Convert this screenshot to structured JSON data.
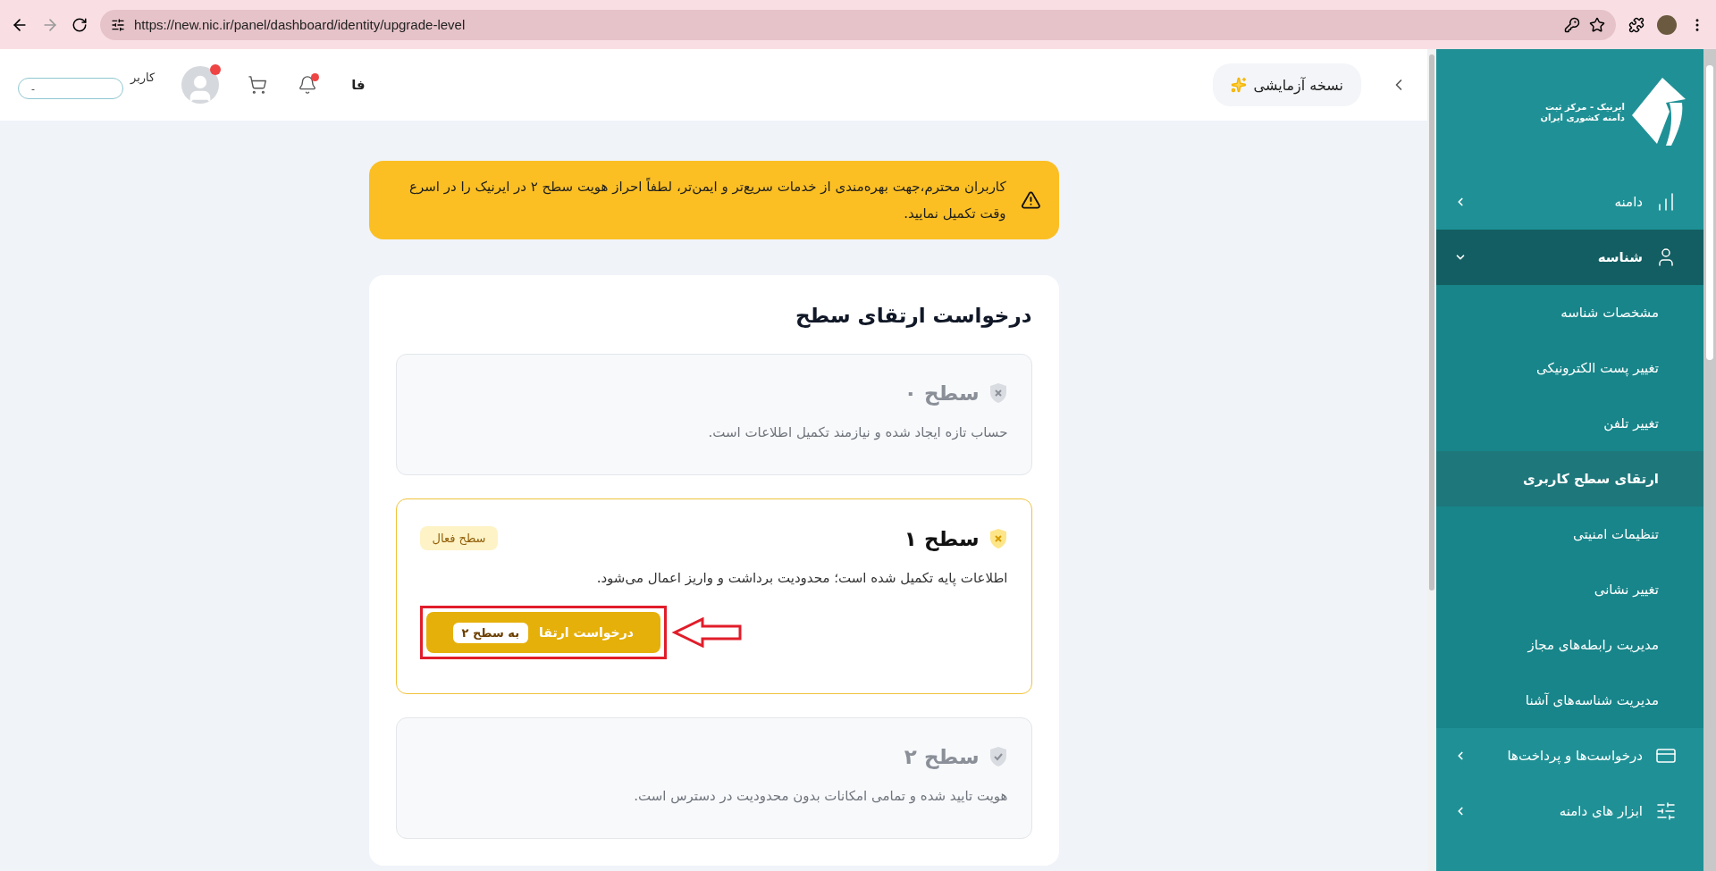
{
  "browser": {
    "url": "https://new.nic.ir/panel/dashboard/identity/upgrade-level"
  },
  "header": {
    "trial_label": "نسخه آزمایشی",
    "language": "فا",
    "user_name": "کاربر",
    "user_value": "-"
  },
  "alert": {
    "text": "کاربران محترم،جهت بهره‌مندی از خدمات سریع‌تر و ایمن‌تر، لطفاً احراز هویت سطح ۲ در ایرنیک را در اسرع وقت تکمیل نمایید."
  },
  "card": {
    "title": "درخواست ارتقای سطح",
    "levels": [
      {
        "title": "سطح ۰",
        "description": "حساب تازه ایجاد شده و نیازمند تکمیل اطلاعات است.",
        "kind": "pending",
        "current": false
      },
      {
        "title": "سطح ۱",
        "description": "اطلاعات پایه تکمیل شده است؛ محدودیت برداشت و واریز اعمال می‌شود.",
        "kind": "pending",
        "current": true,
        "badge": "سطح فعال",
        "button": {
          "label": "درخواست ارتقا",
          "tag": "به سطح ۲"
        }
      },
      {
        "title": "سطح ۲",
        "description": "هویت تایید شده و تمامی امکانات بدون محدودیت در دسترس است.",
        "kind": "verified",
        "current": false
      }
    ]
  },
  "sidebar": {
    "logo_lines": [
      "ایرنیک - مرکز ثبت",
      "دامنه کشوری ایران"
    ],
    "items": [
      {
        "label": "دامنه",
        "kind": "chart",
        "expanded": false
      },
      {
        "label": "شناسه",
        "kind": "user",
        "expanded": true,
        "children": [
          {
            "label": "مشخصات شناسه",
            "selected": false
          },
          {
            "label": "تغییر پست الکترونیکی",
            "selected": false
          },
          {
            "label": "تغییر تلفن",
            "selected": false
          },
          {
            "label": "ارتقای سطح کاربری",
            "selected": true
          },
          {
            "label": "تنظیمات امنیتی",
            "selected": false
          },
          {
            "label": "تغییر نشانی",
            "selected": false
          },
          {
            "label": "مدیریت رابطه‌های مجاز",
            "selected": false
          },
          {
            "label": "مدیریت شناسه‌های آشنا",
            "selected": false
          }
        ]
      },
      {
        "label": "درخواست‌ها و پرداخت‌ها",
        "kind": "card",
        "expanded": false
      },
      {
        "label": "ابزار های دامنه",
        "kind": "tools",
        "expanded": false
      }
    ]
  }
}
